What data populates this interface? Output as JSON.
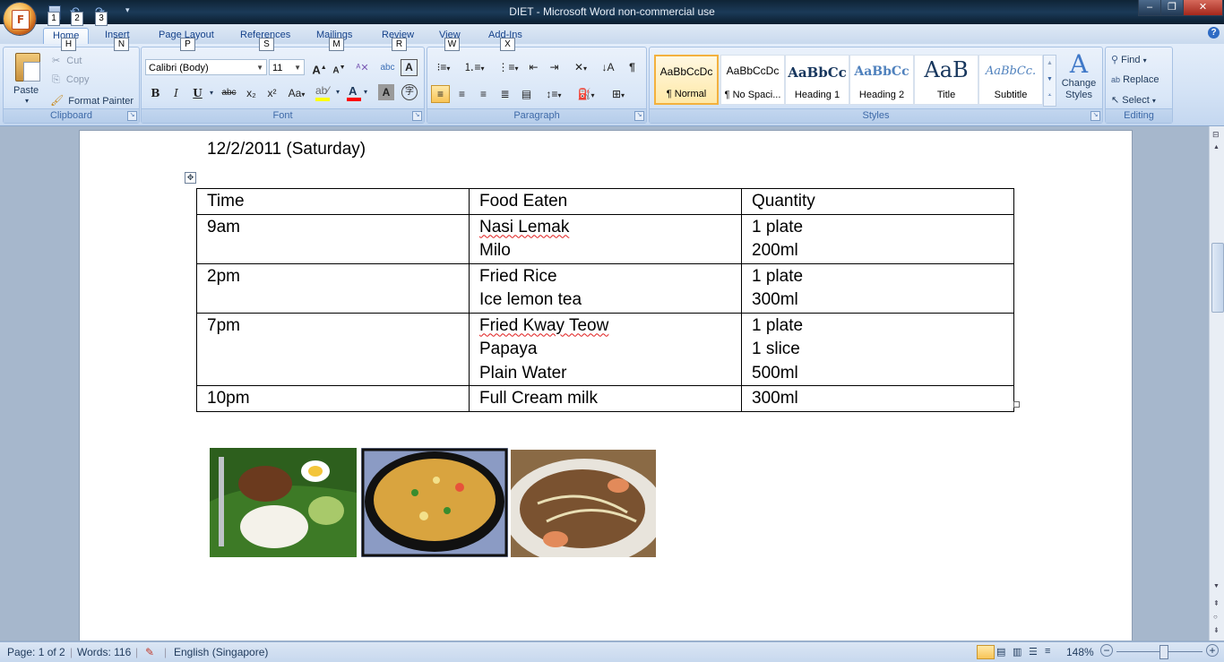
{
  "window": {
    "title": "DIET - Microsoft Word non-commercial use",
    "office_button_key": "F",
    "qat_keys": [
      "1",
      "2",
      "3"
    ],
    "controls": {
      "minimize": "–",
      "maximize": "❐",
      "close": "✕"
    }
  },
  "tabs": [
    {
      "label": "Home",
      "key": "H"
    },
    {
      "label": "Insert",
      "key": "N"
    },
    {
      "label": "Page Layout",
      "key": "P"
    },
    {
      "label": "References",
      "key": "S"
    },
    {
      "label": "Mailings",
      "key": "M"
    },
    {
      "label": "Review",
      "key": "R"
    },
    {
      "label": "View",
      "key": "W"
    },
    {
      "label": "Add-Ins",
      "key": "X"
    }
  ],
  "ribbon": {
    "clipboard": {
      "label": "Clipboard",
      "paste": "Paste",
      "cut": "Cut",
      "copy": "Copy",
      "format_painter": "Format Painter"
    },
    "font": {
      "label": "Font",
      "font_name": "Calibri (Body)",
      "font_size": "11",
      "grow": "A",
      "shrink": "A",
      "bold": "B",
      "italic": "I",
      "underline": "U",
      "strikethrough": "abc",
      "subscript": "x₂",
      "superscript": "x²",
      "change_case": "Aa",
      "highlight_color": "#ffff00",
      "font_color": "#ff0000"
    },
    "paragraph": {
      "label": "Paragraph"
    },
    "styles": {
      "label": "Styles",
      "items": [
        {
          "sample": "AaBbCcDc",
          "name": "¶ Normal"
        },
        {
          "sample": "AaBbCcDc",
          "name": "¶ No Spaci..."
        },
        {
          "sample": "AaBbCc",
          "name": "Heading 1"
        },
        {
          "sample": "AaBbCc",
          "name": "Heading 2"
        },
        {
          "sample": "AaB",
          "name": "Title"
        },
        {
          "sample": "AaBbCc.",
          "name": "Subtitle"
        }
      ],
      "change_styles": "Change Styles"
    },
    "editing": {
      "label": "Editing",
      "find": "Find",
      "replace": "Replace",
      "select": "Select"
    }
  },
  "document": {
    "date_line": "12/2/2011 (Saturday)",
    "table": {
      "headers": [
        "Time",
        "Food Eaten",
        "Quantity"
      ],
      "rows": [
        {
          "time": "9am",
          "foods": [
            "Nasi Lemak",
            "Milo"
          ],
          "quantities": [
            "1 plate",
            "200ml"
          ]
        },
        {
          "time": "2pm",
          "foods": [
            "Fried Rice",
            "Ice lemon tea"
          ],
          "quantities": [
            "1 plate",
            "300ml"
          ]
        },
        {
          "time": "7pm",
          "foods": [
            "Fried Kway Teow",
            "Papaya",
            "Plain Water"
          ],
          "quantities": [
            "1 plate",
            "1 slice",
            "500ml"
          ]
        },
        {
          "time": "10pm",
          "foods": [
            "Full Cream milk"
          ],
          "quantities": [
            "300ml"
          ]
        }
      ]
    }
  },
  "status": {
    "page": "Page: 1 of 2",
    "words": "Words: 116",
    "language": "English (Singapore)",
    "zoom": "148%"
  }
}
